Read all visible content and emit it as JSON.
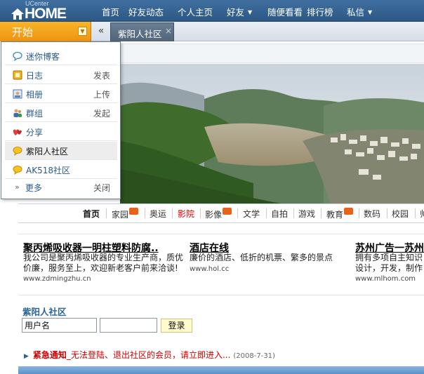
{
  "brand": {
    "logo_small": "UCenter",
    "logo_big": "HOME"
  },
  "nav": [
    {
      "label": "首页",
      "has_caret": false
    },
    {
      "label": "好友动态",
      "has_caret": false
    },
    {
      "label": "个人主页",
      "has_caret": false
    },
    {
      "label": "好友",
      "has_caret": true
    },
    {
      "label": "随便看看",
      "has_caret": false
    },
    {
      "label": "排行榜",
      "has_caret": false
    },
    {
      "label": "私信",
      "has_caret": true
    }
  ],
  "tabbar": {
    "start_label": "开始",
    "collapse_glyph": "«",
    "tab_label": "紫阳人社区",
    "tab_close": "×"
  },
  "menu": {
    "items": [
      {
        "icon": "chat-bubble-icon",
        "label": "迷你博客",
        "action": ""
      },
      {
        "icon": "diary-icon",
        "label": "日志",
        "action": "发表"
      },
      {
        "icon": "photo-album-icon",
        "label": "相册",
        "action": "上传"
      },
      {
        "icon": "group-icon",
        "label": "群组",
        "action": "发起"
      },
      {
        "icon": "share-hearts-icon",
        "label": "分享",
        "action": ""
      },
      {
        "icon": "community-bubble-icon",
        "label": "紫阳人社区",
        "action": ""
      },
      {
        "icon": "community-bubble-icon",
        "label": "AK518社区",
        "action": ""
      }
    ],
    "more_label": "更多",
    "close_label": "关闭",
    "selected_index": 5
  },
  "categories": [
    {
      "label": "首页",
      "hot": false,
      "style": "active"
    },
    {
      "label": "家园",
      "hot": true,
      "style": ""
    },
    {
      "label": "奥运",
      "hot": false,
      "style": ""
    },
    {
      "label": "影院",
      "hot": false,
      "style": "red"
    },
    {
      "label": "影像",
      "hot": true,
      "style": ""
    },
    {
      "label": "文学",
      "hot": false,
      "style": ""
    },
    {
      "label": "自拍",
      "hot": false,
      "style": ""
    },
    {
      "label": "游戏",
      "hot": false,
      "style": ""
    },
    {
      "label": "教育",
      "hot": true,
      "style": ""
    },
    {
      "label": "数码",
      "hot": false,
      "style": ""
    },
    {
      "label": "校园",
      "hot": false,
      "style": ""
    },
    {
      "label": "帅",
      "hot": false,
      "style": ""
    }
  ],
  "ads": [
    {
      "title": "聚丙烯吸收器一明柱塑料防腐..",
      "desc1": "我公司是聚丙烯吸收器的专业生产商，质优",
      "desc2": "价廉，服务至上，欢迎新老客户前来洽谈!",
      "url": "www.zdmingzhu.cn"
    },
    {
      "title": "酒店在线",
      "desc1": "廉价的酒店、低折的机票、繁多的景点",
      "desc2": "",
      "url": "www.hol.cc"
    },
    {
      "title": "苏州广告一苏州",
      "desc1": "拥有多项自主知识",
      "desc2": "设计，开发，制作",
      "url": "www.mlhom.com"
    }
  ],
  "login": {
    "title": "紫阳人社区",
    "username_value": "用户名",
    "password_value": "",
    "button_label": "登录"
  },
  "notice": {
    "label": "紧急通知",
    "text": "_无法登陆、退出社区的会员，请立即进入...",
    "date": "(2008-7-31)"
  },
  "colors": {
    "topbar": "#2d5885",
    "start": "#f0a01a",
    "link_blue": "#2a6496",
    "alert_red": "#d10000"
  }
}
